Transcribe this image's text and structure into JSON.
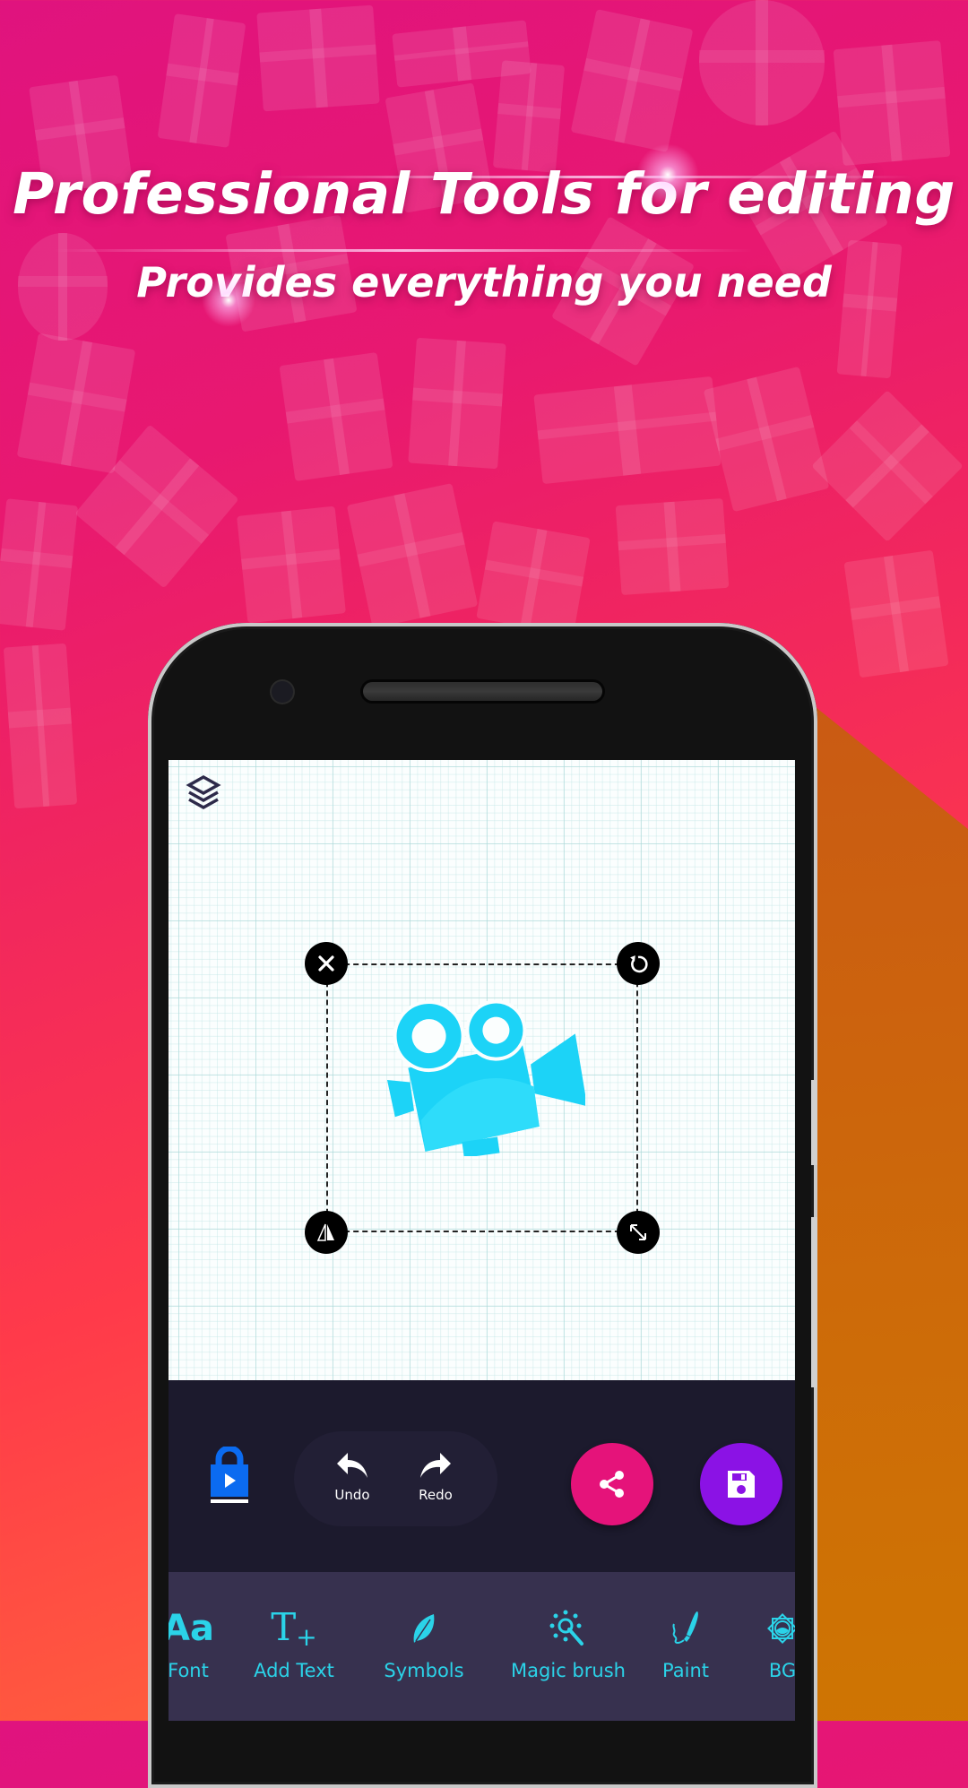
{
  "promo": {
    "title": "Professional Tools for editing",
    "subtitle": "Provides everything you need"
  },
  "canvas": {
    "layers_icon": "layers-icon",
    "selection": {
      "handles": {
        "top_left": "close-icon",
        "top_right": "rotate-icon",
        "bottom_left": "flip-icon",
        "bottom_right": "resize-icon"
      },
      "sticker": "movie-camera-sticker",
      "sticker_color": "#1CD3F7"
    }
  },
  "action_bar": {
    "lock_icon": "lock-play-icon",
    "undo_label": "Undo",
    "redo_label": "Redo",
    "share_icon": "share-icon",
    "save_icon": "save-icon",
    "share_color": "#E5137A",
    "save_color": "#8B12E5",
    "lock_color": "#0B6BF0"
  },
  "tools": [
    {
      "label": "Font",
      "icon": "font-icon"
    },
    {
      "label": "Add Text",
      "icon": "add-text-icon"
    },
    {
      "label": "Symbols",
      "icon": "leaf-icon"
    },
    {
      "label": "Magic brush",
      "icon": "magic-brush-icon"
    },
    {
      "label": "Paint",
      "icon": "paint-brush-icon"
    },
    {
      "label": "BG",
      "icon": "background-icon"
    }
  ],
  "colors": {
    "tool_accent": "#2BD3E8",
    "toolbar_bg": "#1C1A2D",
    "tools_bg": "#37314F"
  }
}
